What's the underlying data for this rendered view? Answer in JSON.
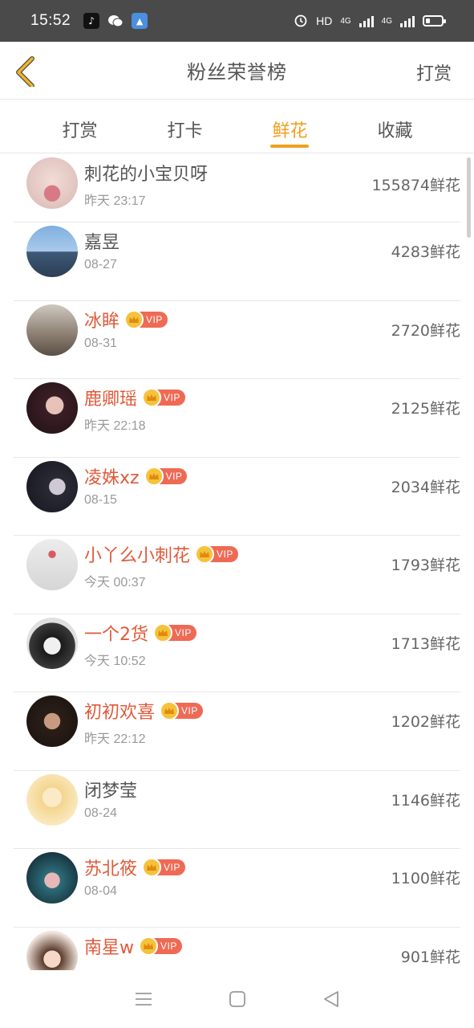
{
  "status_bar": {
    "time": "15:52",
    "network": "HD",
    "signal1": "4G",
    "signal2": "4G"
  },
  "header": {
    "title": "粉丝荣誉榜",
    "action": "打赏"
  },
  "tabs": [
    {
      "label": "打赏",
      "active": false
    },
    {
      "label": "打卡",
      "active": false
    },
    {
      "label": "鲜花",
      "active": true
    },
    {
      "label": "收藏",
      "active": false
    }
  ],
  "vip_label": "VIP",
  "list": [
    {
      "name": "刺花的小宝贝呀",
      "time": "昨天 23:17",
      "count": "155874鲜花",
      "vip": false
    },
    {
      "name": "嘉昱",
      "time": "08-27",
      "count": "4283鲜花",
      "vip": false
    },
    {
      "name": "冰眸",
      "time": "08-31",
      "count": "2720鲜花",
      "vip": true
    },
    {
      "name": "鹿卿瑶",
      "time": "昨天 22:18",
      "count": "2125鲜花",
      "vip": true
    },
    {
      "name": "凌姝xz",
      "time": "08-15",
      "count": "2034鲜花",
      "vip": true
    },
    {
      "name": "小丫么小刺花",
      "time": "今天 00:37",
      "count": "1793鲜花",
      "vip": true
    },
    {
      "name": "一个2货",
      "time": "今天 10:52",
      "count": "1713鲜花",
      "vip": true
    },
    {
      "name": "初初欢喜",
      "time": "昨天 22:12",
      "count": "1202鲜花",
      "vip": true
    },
    {
      "name": "闭梦莹",
      "time": "08-24",
      "count": "1146鲜花",
      "vip": false
    },
    {
      "name": "苏北筱",
      "time": "08-04",
      "count": "1100鲜花",
      "vip": true
    },
    {
      "name": "南星w",
      "time": "",
      "count": "901鲜花",
      "vip": true
    }
  ]
}
